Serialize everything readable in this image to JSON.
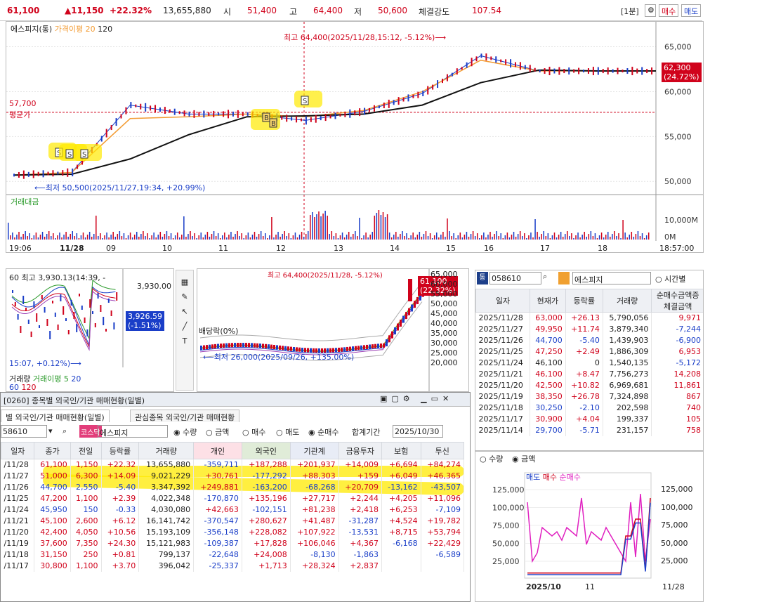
{
  "top": {
    "price": "61,100",
    "change": "▲11,150",
    "pct": "+22.32%",
    "volume": "13,655,880",
    "open_lbl": "시",
    "open": "51,400",
    "high_lbl": "고",
    "high": "64,400",
    "low_lbl": "저",
    "low": "50,600",
    "strength_lbl": "체결강도",
    "strength": "107.54",
    "period": "[1분]",
    "sell_btn": "매수",
    "buy_btn": "매도"
  },
  "main_chart": {
    "legend_name": "에스피지(통)",
    "legend_ma": "가격이평 20",
    "legend_n": "120",
    "high_note": "최고 64,400(2025/11/28,15:12, -5.12%)⟶",
    "low_note": "⟵최저 50,500(2025/11/27,19:34, +20.99%)",
    "avg_val": "57,700",
    "avg_lbl": "평균가",
    "cur_price": "62,300",
    "cur_pct": "(24.72%)",
    "y_ticks": [
      "65,000",
      "60,000",
      "55,000",
      "50,000"
    ],
    "vol_lbl": "거래대금",
    "vol_ticks": [
      "10,000M",
      "0M"
    ],
    "x_ticks": [
      "19:06",
      "11/28",
      "09",
      "10",
      "11",
      "12",
      "13",
      "14",
      "15",
      "16",
      "17",
      "18",
      "18:57:00"
    ],
    "chart_type": "candlestick-intraday",
    "marker_s": "S",
    "marker_b": "B"
  },
  "chart_data": {
    "type": "line",
    "title": "",
    "x": [
      "19:06",
      "11/28",
      "09",
      "10",
      "11",
      "12",
      "13",
      "14",
      "15",
      "16",
      "17",
      "18"
    ],
    "series": [
      {
        "name": "",
        "values": [
          50700,
          51000,
          58500,
          57500,
          57500,
          56800,
          57800,
          59800,
          64000,
          62300,
          62300,
          62300
        ]
      },
      {
        "name": "가격이평 20",
        "values": [
          50700,
          51000,
          57000,
          57200,
          57500,
          57200,
          57900,
          60000,
          63500,
          62300,
          62300,
          62300
        ]
      },
      {
        "name": "120",
        "values": [
          50700,
          50800,
          52500,
          55200,
          57200,
          57300,
          57500,
          58500,
          61000,
          62400,
          62300,
          62300
        ]
      }
    ],
    "ylim": [
      49000,
      67000
    ]
  },
  "index_chart": {
    "title": "60 최고 3,930.13(14:39, -",
    "val": "3,930.00",
    "cur": "3,926.59",
    "cur_pct": "(-1.51%)",
    "note": "15:07, +0.12%)⟶",
    "vol_lbl": "거래량",
    "vol_ma": "거래이평 5",
    "vol_n": "20",
    "l60": "60",
    "l120": "120"
  },
  "daily_chart": {
    "top_note": "최고 64,400(2025/11/28, -5.12%)",
    "div_lbl": "배당락(0%)",
    "low_note": "⟵최저 26,000(2025/09/26, +135.00%)",
    "price": "61,100",
    "pct": "(22.32%)",
    "y_ticks": [
      "65,000",
      "60,000",
      "55,000",
      "50,000",
      "45,000",
      "40,000",
      "35,000",
      "30,000",
      "25,000",
      "20,000"
    ]
  },
  "quote_panel": {
    "code": "058610",
    "name": "에스피지",
    "radio": "시간별",
    "headers": [
      "일자",
      "현재가",
      "등락률",
      "거래량",
      "순매수금액증",
      "체결금액"
    ],
    "rows": [
      [
        "2025/11/28",
        "63,000",
        "+26.13",
        "5,790,056",
        "9,971"
      ],
      [
        "2025/11/27",
        "49,950",
        "+11.74",
        "3,879,340",
        "-7,244"
      ],
      [
        "2025/11/26",
        "44,700",
        "-5.40",
        "1,439,903",
        "-6,900"
      ],
      [
        "2025/11/25",
        "47,250",
        "+2.49",
        "1,886,309",
        "6,953"
      ],
      [
        "2025/11/24",
        "46,100",
        "0",
        "1,540,135",
        "-5,172"
      ],
      [
        "2025/11/21",
        "46,100",
        "+8.47",
        "7,756,273",
        "14,208"
      ],
      [
        "2025/11/20",
        "42,500",
        "+10.82",
        "6,969,681",
        "11,861"
      ],
      [
        "2025/11/19",
        "38,350",
        "+26.78",
        "7,324,898",
        "867"
      ],
      [
        "2025/11/18",
        "30,250",
        "-2.10",
        "202,598",
        "740"
      ],
      [
        "2025/11/17",
        "30,900",
        "+4.04",
        "199,337",
        "105"
      ],
      [
        "2025/11/14",
        "29,700",
        "-5.71",
        "231,157",
        "758"
      ]
    ]
  },
  "flow_chart": {
    "radio_qty": "수량",
    "radio_amt": "금액",
    "leg_sell": "매도",
    "leg_buy": "매수",
    "leg_net": "순매수",
    "y_ticks": [
      "125,000",
      "100,000",
      "75,000",
      "50,000",
      "25,000"
    ],
    "x_ticks": [
      "2025/10",
      "11",
      "11/28"
    ]
  },
  "investor": {
    "window_title": "[0260] 종목별 외국인/기관 매매현황(일별)",
    "tab1": "별 외국인/기관 매매현황(일별)",
    "tab2": "관심종목 외국인/기관 매매현황",
    "code": "58610",
    "market": "코스닥",
    "name": "에스피지",
    "r_qty": "수량",
    "r_amt": "금액",
    "r_buy": "매수",
    "r_sell": "매도",
    "r_net": "순매수",
    "period_lbl": "합계기간",
    "date": "2025/10/30",
    "headers": [
      "일자",
      "종가",
      "전일",
      "등락률",
      "거래량",
      "개인",
      "외국인",
      "기관계",
      "기관",
      "금융투자",
      "보험",
      "투신"
    ],
    "rows": [
      [
        "/11/28",
        "61,100",
        "1,150",
        "+22.32",
        "13,655,880",
        "-359,711",
        "+187,288",
        "+201,937",
        "+14,009",
        "+6,694",
        "+84,274"
      ],
      [
        "/11/27",
        "51,000",
        "6,300",
        "+14.09",
        "9,021,229",
        "+30,761",
        "-177,292",
        "+88,303",
        "+159",
        "+6,049",
        "+46,365"
      ],
      [
        "/11/26",
        "44,700",
        "2,550",
        "-5.40",
        "3,347,392",
        "+249,881",
        "-163,200",
        "-68,268",
        "+20,709",
        "-13,162",
        "-43,507"
      ],
      [
        "/11/25",
        "47,200",
        "1,100",
        "+2.39",
        "4,022,348",
        "-170,870",
        "+135,196",
        "+27,717",
        "+2,244",
        "+4,205",
        "+11,096"
      ],
      [
        "/11/24",
        "45,950",
        "150",
        "-0.33",
        "4,030,080",
        "+42,663",
        "-102,151",
        "+81,238",
        "+2,418",
        "+6,253",
        "-7,109"
      ],
      [
        "/11/21",
        "45,100",
        "2,600",
        "+6.12",
        "16,141,742",
        "-370,547",
        "+280,627",
        "+41,487",
        "-31,287",
        "+4,524",
        "+19,782"
      ],
      [
        "/11/20",
        "42,400",
        "4,050",
        "+10.56",
        "15,193,109",
        "-356,148",
        "+228,082",
        "+107,922",
        "-13,531",
        "+8,715",
        "+53,794"
      ],
      [
        "/11/19",
        "37,600",
        "7,350",
        "+24.30",
        "15,121,983",
        "-109,387",
        "+17,828",
        "+106,046",
        "+4,367",
        "-6,168",
        "+22,429"
      ],
      [
        "/11/18",
        "31,150",
        "250",
        "+0.81",
        "799,137",
        "-22,648",
        "+24,008",
        "-8,130",
        "-1,863",
        "",
        "-6,589"
      ],
      [
        "/11/17",
        "30,800",
        "1,100",
        "+3.70",
        "396,042",
        "-25,337",
        "+1,713",
        "+28,324",
        "+2,837",
        "",
        ""
      ]
    ]
  }
}
